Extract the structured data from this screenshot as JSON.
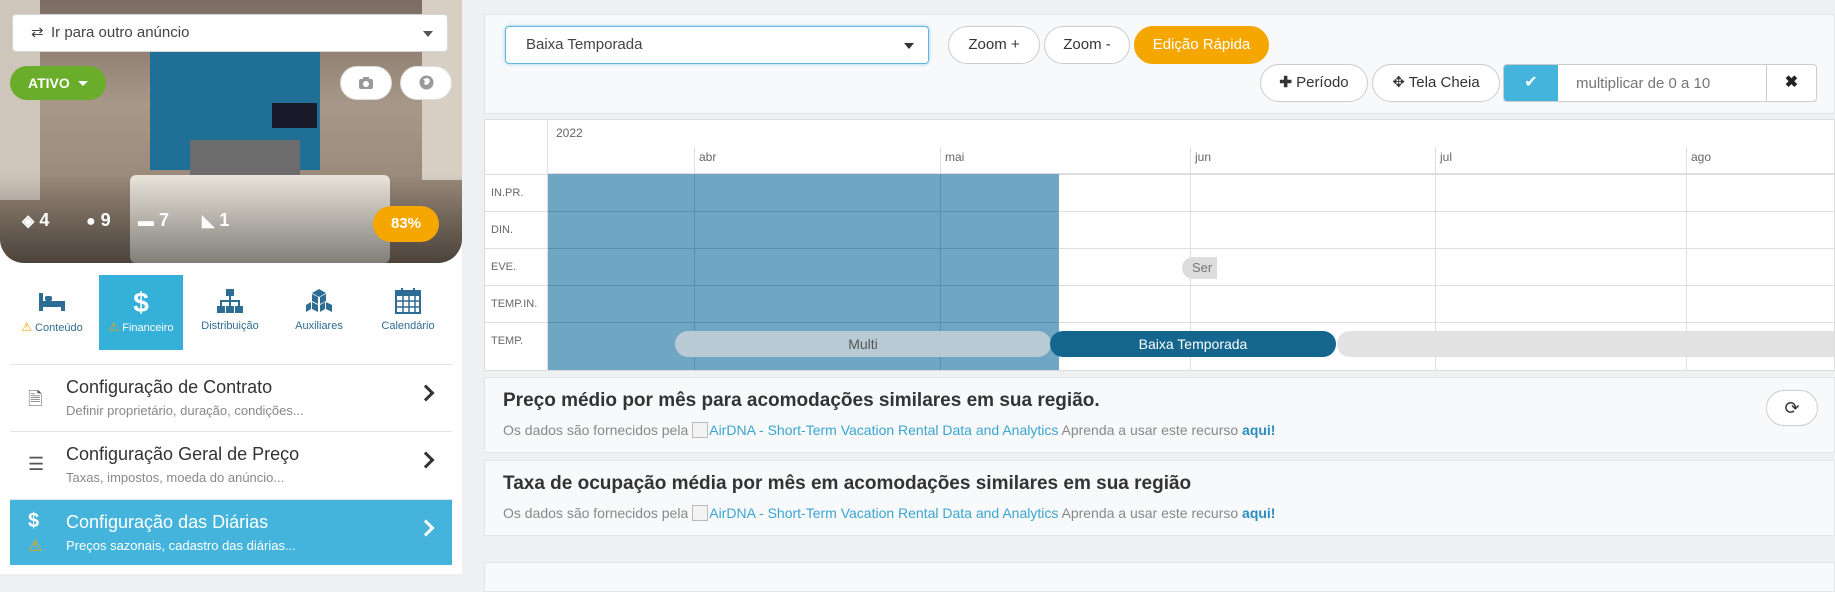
{
  "listing": {
    "goto_label": "Ir para outro anúncio",
    "status_label": "ATIVO",
    "stats": {
      "rooms": "4",
      "guests": "9",
      "beds": "7",
      "baths": "1"
    },
    "score": "83%"
  },
  "tabs": [
    {
      "label": "Conteúdo",
      "warning": true
    },
    {
      "label": "Financeiro",
      "warning": true,
      "active": true
    },
    {
      "label": "Distribuição"
    },
    {
      "label": "Auxiliares"
    },
    {
      "label": "Calendário"
    }
  ],
  "menu": [
    {
      "title": "Configuração de Contrato",
      "subtitle": "Definir proprietário, duração, condições..."
    },
    {
      "title": "Configuração Geral de Preço",
      "subtitle": "Taxas, impostos, moeda do anúncio..."
    },
    {
      "title": "Configuração das Diárias",
      "subtitle": "Preços sazonais, cadastro das diárias...",
      "active": true
    }
  ],
  "toolbar": {
    "season_selected": "Baixa Temporada",
    "zoom_in": "Zoom +",
    "zoom_out": "Zoom -",
    "quick_edit": "Edição Rápida",
    "period": "Período",
    "fullscreen": "Tela Cheia",
    "multiply_placeholder": "multiplicar de 0 a 10"
  },
  "timeline": {
    "year": "2022",
    "months": [
      "abr",
      "mai",
      "jun",
      "jul",
      "ago"
    ],
    "rows": [
      "IN.PR.",
      "DIN.",
      "EVE.",
      "TEMP.IN.",
      "TEMP."
    ],
    "event_label": "Ser",
    "season_bars": {
      "multi": "Multi",
      "baixa": "Baixa Temporada"
    }
  },
  "cards": {
    "avg_price_title": "Preço médio por mês para acomodações similares em sua região.",
    "occupancy_title": "Taxa de ocupação média por mês em acomodações similares em sua região",
    "source_prefix": "Os dados são fornecidos pela",
    "source_link": "AirDNA - Short-Term Vacation Rental Data and Analytics",
    "learn_text": "Aprenda a usar este recurso",
    "learn_link": "aqui!"
  },
  "colors": {
    "accent_blue": "#34b0d9",
    "orange": "#f5a700",
    "green": "#6aad2a",
    "season_dark": "#14668f"
  }
}
